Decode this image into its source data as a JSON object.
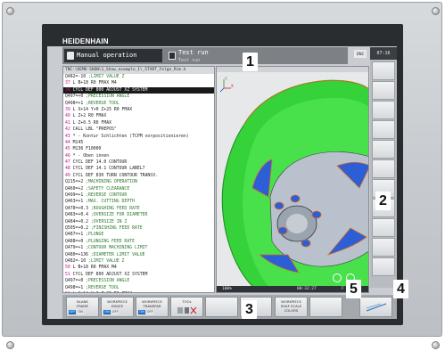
{
  "brand": "HEIDENHAIN",
  "modes": {
    "manual": "Manual operation",
    "test": "Test run",
    "test_sub": "Test run"
  },
  "dnc": "DNC",
  "clock": "07:16",
  "program_path": "TNC:\\DEMO-SHOW\\1_Show_example_1\\_START_Felge_Rim.h",
  "program_lines": [
    {
      "n": "",
      "t": "    Q482=-10",
      "c": ";LIMIT VALUE Z"
    },
    {
      "n": "37",
      "t": " L  B+18 R0 FMAX M4",
      "c": ""
    },
    {
      "n": "38",
      "t": " CYCL DEF 800 ADJUST XZ SYSTEM",
      "c": "",
      "sel": true
    },
    {
      "n": "",
      "t": "    Q497=+0",
      "c": ";PRECESSION ANGLE"
    },
    {
      "n": "",
      "t": "    Q498=+1",
      "c": ";REVERSE TOOL"
    },
    {
      "n": "39",
      "t": " L  X+14  Y+0  Z+25 R0 FMAX",
      "c": ""
    },
    {
      "n": "40",
      "t": " L  Z+2 R0 FMAX",
      "c": ""
    },
    {
      "n": "41",
      "t": " L  Z+0.5 R0 FMAX",
      "c": ""
    },
    {
      "n": "42",
      "t": " CALL LBL \"PREPOS\"",
      "c": ""
    },
    {
      "n": "43",
      "t": " * - Kontur Schlichten (TCPM vorpositionieren)",
      "c": ""
    },
    {
      "n": "44",
      "t": " M145",
      "c": ""
    },
    {
      "n": "45",
      "t": " M136 F10000",
      "c": ""
    },
    {
      "n": "46",
      "t": " *  - Oben innen",
      "c": ""
    },
    {
      "n": "47",
      "t": " CYCL DEF 14.0 CONTOUR",
      "c": ""
    },
    {
      "n": "48",
      "t": " CYCL DEF 14.1 CONTOUR LABEL7",
      "c": ""
    },
    {
      "n": "49",
      "t": " CYCL DEF 830 TURN CONTOUR TRANSV.",
      "c": ""
    },
    {
      "n": "",
      "t": "    Q215=+2",
      "c": ";MACHINING OPERATION"
    },
    {
      "n": "",
      "t": "    Q460=+2",
      "c": ";SAFETY CLEARANCE"
    },
    {
      "n": "",
      "t": "    Q499=+1",
      "c": ";REVERSE CONTOUR"
    },
    {
      "n": "",
      "t": "    Q463=+1",
      "c": ";MAX. CUTTING DEPTH"
    },
    {
      "n": "",
      "t": "    Q478=+0.3",
      "c": ";ROUGHING FEED RATE"
    },
    {
      "n": "",
      "t": "    Q483=+0.4",
      "c": ";OVERSIZE FOR DIAMETER"
    },
    {
      "n": "",
      "t": "    Q484=+0.2",
      "c": ";OVERSIZE IN Z"
    },
    {
      "n": "",
      "t": "    Q505=+0.2",
      "c": ";FINISHING FEED RATE"
    },
    {
      "n": "",
      "t": "    Q487=+1",
      "c": ";PLUNGE"
    },
    {
      "n": "",
      "t": "    Q488=+0",
      "c": ";PLUNGING FEED RATE"
    },
    {
      "n": "",
      "t": "    Q479=+1",
      "c": ";CONTOUR MACHINING LIMIT"
    },
    {
      "n": "",
      "t": "    Q480=+136",
      "c": ";DIAMETER LIMIT VALUE"
    },
    {
      "n": "",
      "t": "    Q482=-10",
      "c": ";LIMIT VALUE Z"
    },
    {
      "n": "50",
      "t": " L  B+18 R0 FMAX M4",
      "c": ""
    },
    {
      "n": "51",
      "t": " CYCL DEF 800 ADJUST XZ SYSTEM",
      "c": ""
    },
    {
      "n": "",
      "t": "    Q497=+0",
      "c": ";PRECESSION ANGLE"
    },
    {
      "n": "",
      "t": "    Q498=+1",
      "c": ";REVERSE TOOL"
    },
    {
      "n": "52",
      "t": " L  X+14  Y+0  Z+25 R0 FMAX",
      "c": ""
    }
  ],
  "gfx_status": {
    "left": "100%",
    "time": "00:32:27",
    "right": "F"
  },
  "softkeys": [
    {
      "label": "BLANK\nFRAME",
      "on": "OFF",
      "off": "ON"
    },
    {
      "label": "WORKPIECE\nEDGES",
      "on": "ON",
      "off": "OFF"
    },
    {
      "label": "WORKPIECE\nTRANSPAR",
      "on": "ON",
      "off": "OFF"
    },
    {
      "label": "TOOL",
      "on": "",
      "off": ""
    },
    {
      "label": "",
      "on": "",
      "off": ""
    },
    {
      "label": "",
      "on": "",
      "off": ""
    },
    {
      "label": "WORKPIECE\nSHAF SCALE\nCOLORS",
      "on": "",
      "off": ""
    },
    {
      "label": "",
      "on": "",
      "off": ""
    },
    {
      "label": "",
      "on": "",
      "off": ""
    }
  ],
  "callouts": [
    "1",
    "2",
    "3",
    "4",
    "5"
  ],
  "colors": {
    "accent_blue": "#1d6fc2",
    "wheel_green": "#35d23a",
    "wheel_blue": "#2c5fd6",
    "wheel_orange": "#e06a1c",
    "highlight_bar": "#1a1a1a"
  },
  "icons": [
    "screw-icon",
    "manual-mode-icon",
    "test-run-icon",
    "axis-triad-icon",
    "rotate-view-icon",
    "reset-view-icon",
    "tool-icon"
  ]
}
